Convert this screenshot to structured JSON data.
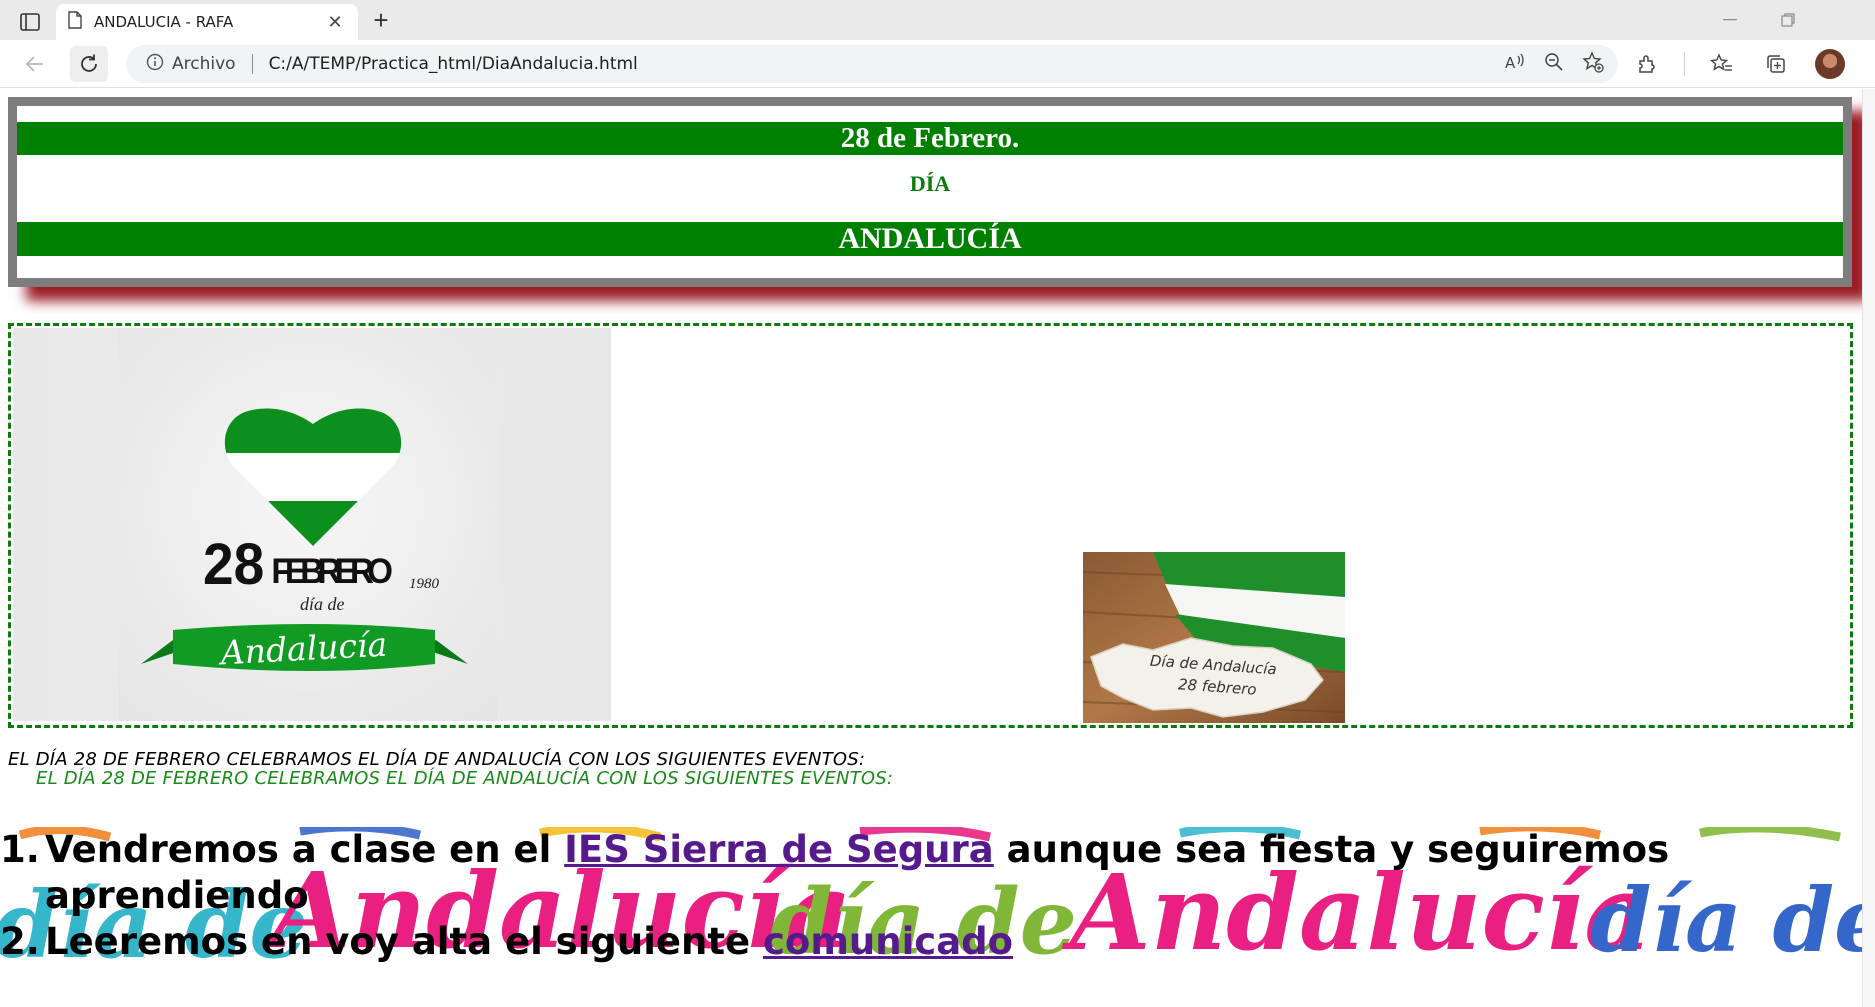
{
  "browser": {
    "tab": {
      "title": "ANDALUCIA - RAFA"
    },
    "address": {
      "scheme_label": "Archivo",
      "url": "C:/A/TEMP/Practica_html/DiaAndalucia.html"
    }
  },
  "page": {
    "header": {
      "line1": "28 de Febrero.",
      "line2": "DÍA",
      "line3": "ANDALUCÍA"
    },
    "poster": {
      "day": "28",
      "month": "FEBRERO",
      "year": "1980",
      "dia_de": "día de",
      "banner": "Andalucía"
    },
    "photo": {
      "note_line1": "Día de Andalucía",
      "note_line2": "28 febrero"
    },
    "intro": {
      "line1": "EL DÍA 28 DE FEBRERO CELEBRAMOS EL DÍA DE ANDALUCÍA CON LOS SIGUIENTES EVENTOS:",
      "line2": "EL DÍA 28 DE FEBRERO CELEBRAMOS EL DÍA DE ANDALUCÍA CON LOS SIGUIENTES EVENTOS:"
    },
    "events": [
      {
        "number": "1.",
        "before": "Vendremos a clase en el ",
        "link": "IES Sierra de Segura",
        "after": " aunque sea fiesta y seguiremos aprendiendo"
      },
      {
        "number": "2.",
        "before": "Leeremos en voy alta el siguiente ",
        "link": "comunicado",
        "after": ""
      }
    ],
    "background_word_1": "día de",
    "background_word_2": "Andalucía",
    "colors": {
      "green": "#008000",
      "frame_gray": "#7d7d7d",
      "shadow_red": "#9c1c26",
      "link_visited": "#551a8b"
    }
  }
}
